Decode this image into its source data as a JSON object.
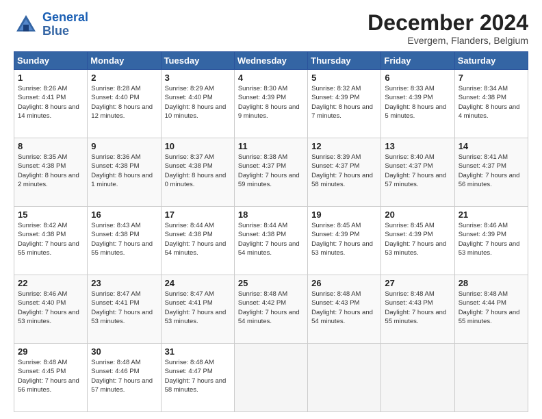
{
  "header": {
    "logo_line1": "General",
    "logo_line2": "Blue",
    "month_title": "December 2024",
    "subtitle": "Evergem, Flanders, Belgium"
  },
  "weekdays": [
    "Sunday",
    "Monday",
    "Tuesday",
    "Wednesday",
    "Thursday",
    "Friday",
    "Saturday"
  ],
  "weeks": [
    [
      {
        "day": "1",
        "sunrise": "Sunrise: 8:26 AM",
        "sunset": "Sunset: 4:41 PM",
        "daylight": "Daylight: 8 hours and 14 minutes."
      },
      {
        "day": "2",
        "sunrise": "Sunrise: 8:28 AM",
        "sunset": "Sunset: 4:40 PM",
        "daylight": "Daylight: 8 hours and 12 minutes."
      },
      {
        "day": "3",
        "sunrise": "Sunrise: 8:29 AM",
        "sunset": "Sunset: 4:40 PM",
        "daylight": "Daylight: 8 hours and 10 minutes."
      },
      {
        "day": "4",
        "sunrise": "Sunrise: 8:30 AM",
        "sunset": "Sunset: 4:39 PM",
        "daylight": "Daylight: 8 hours and 9 minutes."
      },
      {
        "day": "5",
        "sunrise": "Sunrise: 8:32 AM",
        "sunset": "Sunset: 4:39 PM",
        "daylight": "Daylight: 8 hours and 7 minutes."
      },
      {
        "day": "6",
        "sunrise": "Sunrise: 8:33 AM",
        "sunset": "Sunset: 4:39 PM",
        "daylight": "Daylight: 8 hours and 5 minutes."
      },
      {
        "day": "7",
        "sunrise": "Sunrise: 8:34 AM",
        "sunset": "Sunset: 4:38 PM",
        "daylight": "Daylight: 8 hours and 4 minutes."
      }
    ],
    [
      {
        "day": "8",
        "sunrise": "Sunrise: 8:35 AM",
        "sunset": "Sunset: 4:38 PM",
        "daylight": "Daylight: 8 hours and 2 minutes."
      },
      {
        "day": "9",
        "sunrise": "Sunrise: 8:36 AM",
        "sunset": "Sunset: 4:38 PM",
        "daylight": "Daylight: 8 hours and 1 minute."
      },
      {
        "day": "10",
        "sunrise": "Sunrise: 8:37 AM",
        "sunset": "Sunset: 4:38 PM",
        "daylight": "Daylight: 8 hours and 0 minutes."
      },
      {
        "day": "11",
        "sunrise": "Sunrise: 8:38 AM",
        "sunset": "Sunset: 4:37 PM",
        "daylight": "Daylight: 7 hours and 59 minutes."
      },
      {
        "day": "12",
        "sunrise": "Sunrise: 8:39 AM",
        "sunset": "Sunset: 4:37 PM",
        "daylight": "Daylight: 7 hours and 58 minutes."
      },
      {
        "day": "13",
        "sunrise": "Sunrise: 8:40 AM",
        "sunset": "Sunset: 4:37 PM",
        "daylight": "Daylight: 7 hours and 57 minutes."
      },
      {
        "day": "14",
        "sunrise": "Sunrise: 8:41 AM",
        "sunset": "Sunset: 4:37 PM",
        "daylight": "Daylight: 7 hours and 56 minutes."
      }
    ],
    [
      {
        "day": "15",
        "sunrise": "Sunrise: 8:42 AM",
        "sunset": "Sunset: 4:38 PM",
        "daylight": "Daylight: 7 hours and 55 minutes."
      },
      {
        "day": "16",
        "sunrise": "Sunrise: 8:43 AM",
        "sunset": "Sunset: 4:38 PM",
        "daylight": "Daylight: 7 hours and 55 minutes."
      },
      {
        "day": "17",
        "sunrise": "Sunrise: 8:44 AM",
        "sunset": "Sunset: 4:38 PM",
        "daylight": "Daylight: 7 hours and 54 minutes."
      },
      {
        "day": "18",
        "sunrise": "Sunrise: 8:44 AM",
        "sunset": "Sunset: 4:38 PM",
        "daylight": "Daylight: 7 hours and 54 minutes."
      },
      {
        "day": "19",
        "sunrise": "Sunrise: 8:45 AM",
        "sunset": "Sunset: 4:39 PM",
        "daylight": "Daylight: 7 hours and 53 minutes."
      },
      {
        "day": "20",
        "sunrise": "Sunrise: 8:45 AM",
        "sunset": "Sunset: 4:39 PM",
        "daylight": "Daylight: 7 hours and 53 minutes."
      },
      {
        "day": "21",
        "sunrise": "Sunrise: 8:46 AM",
        "sunset": "Sunset: 4:39 PM",
        "daylight": "Daylight: 7 hours and 53 minutes."
      }
    ],
    [
      {
        "day": "22",
        "sunrise": "Sunrise: 8:46 AM",
        "sunset": "Sunset: 4:40 PM",
        "daylight": "Daylight: 7 hours and 53 minutes."
      },
      {
        "day": "23",
        "sunrise": "Sunrise: 8:47 AM",
        "sunset": "Sunset: 4:41 PM",
        "daylight": "Daylight: 7 hours and 53 minutes."
      },
      {
        "day": "24",
        "sunrise": "Sunrise: 8:47 AM",
        "sunset": "Sunset: 4:41 PM",
        "daylight": "Daylight: 7 hours and 53 minutes."
      },
      {
        "day": "25",
        "sunrise": "Sunrise: 8:48 AM",
        "sunset": "Sunset: 4:42 PM",
        "daylight": "Daylight: 7 hours and 54 minutes."
      },
      {
        "day": "26",
        "sunrise": "Sunrise: 8:48 AM",
        "sunset": "Sunset: 4:43 PM",
        "daylight": "Daylight: 7 hours and 54 minutes."
      },
      {
        "day": "27",
        "sunrise": "Sunrise: 8:48 AM",
        "sunset": "Sunset: 4:43 PM",
        "daylight": "Daylight: 7 hours and 55 minutes."
      },
      {
        "day": "28",
        "sunrise": "Sunrise: 8:48 AM",
        "sunset": "Sunset: 4:44 PM",
        "daylight": "Daylight: 7 hours and 55 minutes."
      }
    ],
    [
      {
        "day": "29",
        "sunrise": "Sunrise: 8:48 AM",
        "sunset": "Sunset: 4:45 PM",
        "daylight": "Daylight: 7 hours and 56 minutes."
      },
      {
        "day": "30",
        "sunrise": "Sunrise: 8:48 AM",
        "sunset": "Sunset: 4:46 PM",
        "daylight": "Daylight: 7 hours and 57 minutes."
      },
      {
        "day": "31",
        "sunrise": "Sunrise: 8:48 AM",
        "sunset": "Sunset: 4:47 PM",
        "daylight": "Daylight: 7 hours and 58 minutes."
      },
      null,
      null,
      null,
      null
    ]
  ]
}
